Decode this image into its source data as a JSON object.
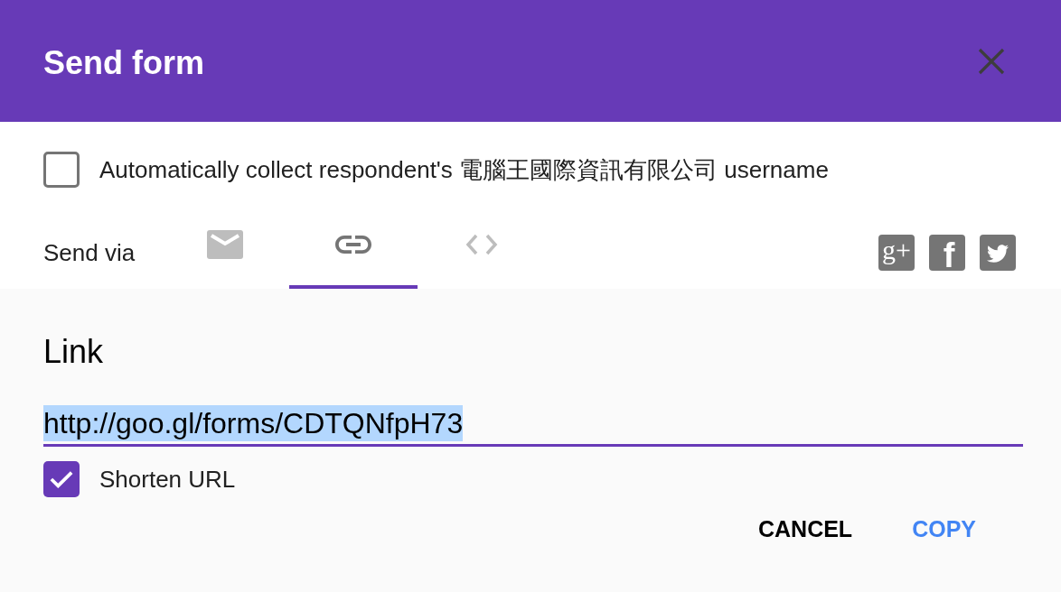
{
  "dialog": {
    "title": "Send form"
  },
  "collect_username": {
    "label": "Automatically collect respondent's 電腦王國際資訊有限公司 username",
    "checked": false
  },
  "send_via": {
    "label": "Send via",
    "tabs": [
      {
        "kind": "email",
        "selected": false
      },
      {
        "kind": "link",
        "selected": true
      },
      {
        "kind": "embed",
        "selected": false
      }
    ],
    "share": [
      {
        "kind": "google_plus",
        "glyph": "g+"
      },
      {
        "kind": "facebook",
        "glyph": "f"
      },
      {
        "kind": "twitter"
      }
    ]
  },
  "link_panel": {
    "heading": "Link",
    "url": {
      "value": "http://goo.gl/forms/CDTQNfpH73",
      "text_highlighted": true
    },
    "shorten_url": {
      "label": "Shorten URL",
      "checked": true
    }
  },
  "buttons": [
    {
      "label": "CANCEL",
      "kind": "plain"
    },
    {
      "label": "COPY",
      "kind": "primary"
    }
  ]
}
